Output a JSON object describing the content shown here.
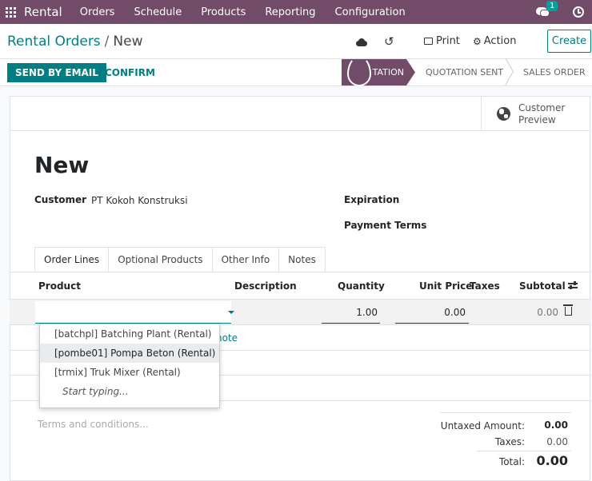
{
  "topbar": {
    "brand": "Rental",
    "nav": [
      "Orders",
      "Schedule",
      "Products",
      "Reporting",
      "Configuration"
    ],
    "chat_badge": "1"
  },
  "controlpanel": {
    "breadcrumb_parent": "Rental Orders",
    "breadcrumb_separator": "/",
    "breadcrumb_current": "New",
    "print_label": "Print",
    "action_label": "Action",
    "create_label": "Create"
  },
  "statusbar": {
    "send_email_label": "SEND BY EMAIL",
    "confirm_label": "CONFIRM",
    "stages": [
      "TATION",
      "QUOTATION SENT",
      "SALES ORDER"
    ]
  },
  "sheet": {
    "preview_label": "Customer Preview",
    "title": "New",
    "customer_label": "Customer",
    "customer_value": "PT Kokoh Konstruksi",
    "expiration_label": "Expiration",
    "payment_terms_label": "Payment Terms"
  },
  "tabs": [
    "Order Lines",
    "Optional Products",
    "Other Info",
    "Notes"
  ],
  "table": {
    "headers": {
      "product": "Product",
      "description": "Description",
      "quantity": "Quantity",
      "unit_price": "Unit Price",
      "taxes": "Taxes",
      "subtotal": "Subtotal"
    },
    "edit_row": {
      "quantity": "1.00",
      "unit_price": "0.00",
      "subtotal": "0.00"
    },
    "add_note_fragment": "note"
  },
  "dropdown": {
    "items": [
      "[batchpl] Batching Plant (Rental)",
      "[pombe01] Pompa Beton (Rental)",
      "[trmix] Truk Mixer (Rental)"
    ],
    "hint": "Start typing..."
  },
  "footer": {
    "terms_placeholder": "Terms and conditions...",
    "untaxed_label": "Untaxed Amount:",
    "untaxed_value": "0.00",
    "taxes_label": "Taxes:",
    "taxes_value": "0.00",
    "total_label": "Total:",
    "total_value": "0.00"
  },
  "colors": {
    "brand": "#714B67",
    "primary": "#017E84"
  }
}
